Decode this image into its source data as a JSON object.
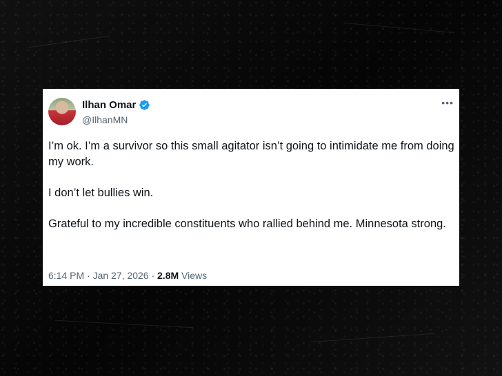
{
  "tweet": {
    "display_name": "Ilhan Omar",
    "handle": "@IlhanMN",
    "paragraphs": [
      "I’m ok. I’m a survivor so this small agitator isn’t going to intimidate me from doing my work.",
      "I don’t let bullies win.",
      "Grateful to my incredible constituents who rallied behind me. Minnesota strong."
    ],
    "time": "6:14 PM",
    "separator": "·",
    "date": "Jan 27, 2026",
    "views_count": "2.8M",
    "views_label": "Views",
    "more_icon": "•••"
  },
  "colors": {
    "background": "#0a0a0a",
    "card": "#ffffff",
    "text_primary": "#0f1419",
    "text_secondary": "#536471",
    "verified_blue": "#1d9bf0"
  },
  "icons": {
    "verified": "verified-badge-icon",
    "more": "more-options-icon"
  }
}
